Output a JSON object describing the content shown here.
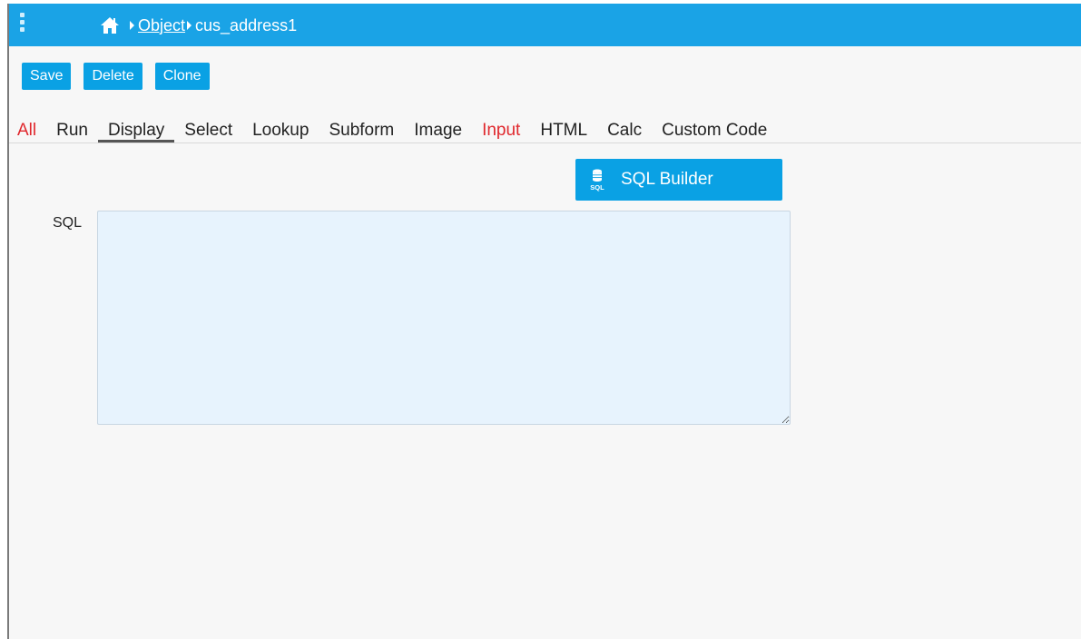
{
  "breadcrumb": {
    "home_icon": "home-icon",
    "object_link": "Object",
    "current": "cus_address1"
  },
  "toolbar": {
    "save_label": "Save",
    "delete_label": "Delete",
    "clone_label": "Clone"
  },
  "tabs": [
    {
      "label": "All",
      "color": "#e0282d"
    },
    {
      "label": "Run"
    },
    {
      "label": "Display",
      "active": true
    },
    {
      "label": "Select"
    },
    {
      "label": "Lookup"
    },
    {
      "label": "Subform"
    },
    {
      "label": "Image"
    },
    {
      "label": "Input",
      "color": "#e0282d"
    },
    {
      "label": "HTML"
    },
    {
      "label": "Calc"
    },
    {
      "label": "Custom Code"
    }
  ],
  "sql_builder": {
    "label": "SQL Builder",
    "icon": "database-sql-icon"
  },
  "form": {
    "sql_label": "SQL",
    "sql_value": ""
  },
  "colors": {
    "topbar": "#1aa3e6",
    "button": "#0aa1e4",
    "highlight_tab": "#e0282d",
    "textarea_bg": "#e7f3fd"
  }
}
